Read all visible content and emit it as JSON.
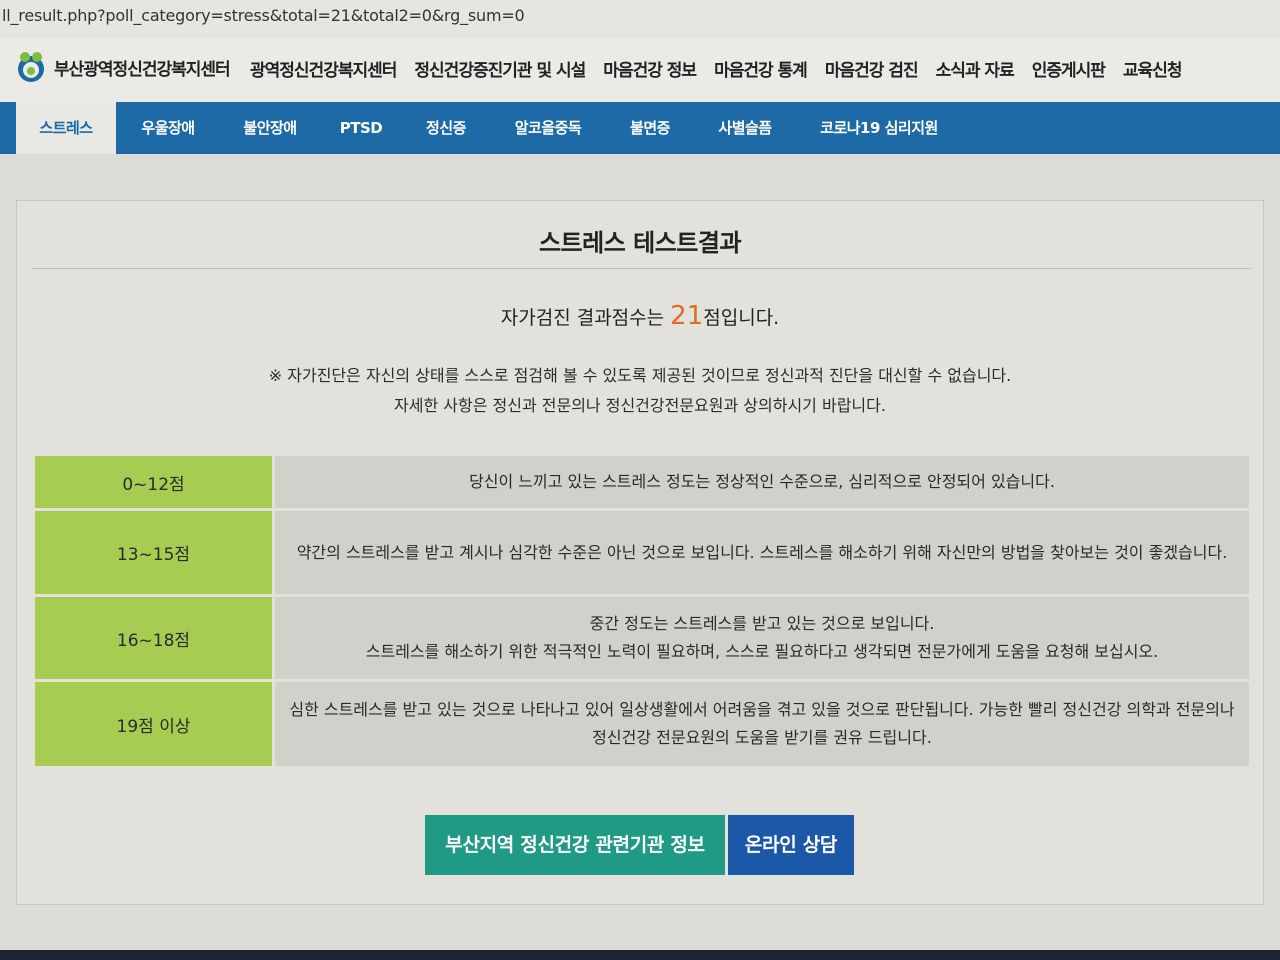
{
  "browser": {
    "url": "ll_result.php?poll_category=stress&total=21&total2=0&rg_sum=0"
  },
  "header": {
    "logo_text": "부산광역정신건강복지센터",
    "nav": [
      "광역정신건강복지센터",
      "정신건강증진기관 및 시설",
      "마음건강 정보",
      "마음건강 통계",
      "마음건강 검진",
      "소식과 자료",
      "인증게시판",
      "교육신청"
    ]
  },
  "subnav": {
    "tabs": [
      "스트레스",
      "우울장애",
      "불안장애",
      "PTSD",
      "정신증",
      "알코올중독",
      "불면증",
      "사별슬픔",
      "코로나19 심리지원"
    ],
    "active_index": 0
  },
  "result": {
    "title": "스트레스 테스트결과",
    "score_prefix": "자가검진 결과점수는 ",
    "score_value": "21",
    "score_suffix": "점입니다.",
    "notice_line1": "※ 자가진단은 자신의 상태를 스스로 점검해 볼 수 있도록 제공된 것이므로 정신과적 진단을 대신할 수 없습니다.",
    "notice_line2": "자세한 사항은 정신과 전문의나 정신건강전문요원과 상의하시기 바랍니다."
  },
  "table": [
    {
      "range": "0~12점",
      "desc": "당신이 느끼고 있는 스트레스 정도는 정상적인 수준으로, 심리적으로 안정되어 있습니다."
    },
    {
      "range": "13~15점",
      "desc": "약간의 스트레스를 받고 계시나 심각한 수준은 아닌 것으로 보입니다. 스트레스를 해소하기 위해 자신만의 방법을 찾아보는 것이 좋겠습니다."
    },
    {
      "range": "16~18점",
      "desc_line1": "중간 정도는 스트레스를 받고 있는 것으로 보입니다.",
      "desc_line2": "스트레스를 해소하기 위한 적극적인 노력이 필요하며, 스스로 필요하다고 생각되면 전문가에게 도움을 요청해 보십시오."
    },
    {
      "range": "19점 이상",
      "desc": "심한 스트레스를 받고 있는 것으로 나타나고 있어 일상생활에서 어려움을 겪고 있을 것으로 판단됩니다. 가능한 빨리 정신건강 의학과 전문의나 정신건강 전문요원의 도움을 받기를 권유 드립니다."
    }
  ],
  "buttons": {
    "agencies": "부산지역 정신건강 관련기관 정보",
    "counsel": "온라인 상담"
  },
  "colors": {
    "nav_blue": "#1e6aa6",
    "range_green": "#a6cd52",
    "score_orange": "#e06a1e",
    "button_teal": "#1f9a85",
    "button_blue": "#1c58a8"
  }
}
